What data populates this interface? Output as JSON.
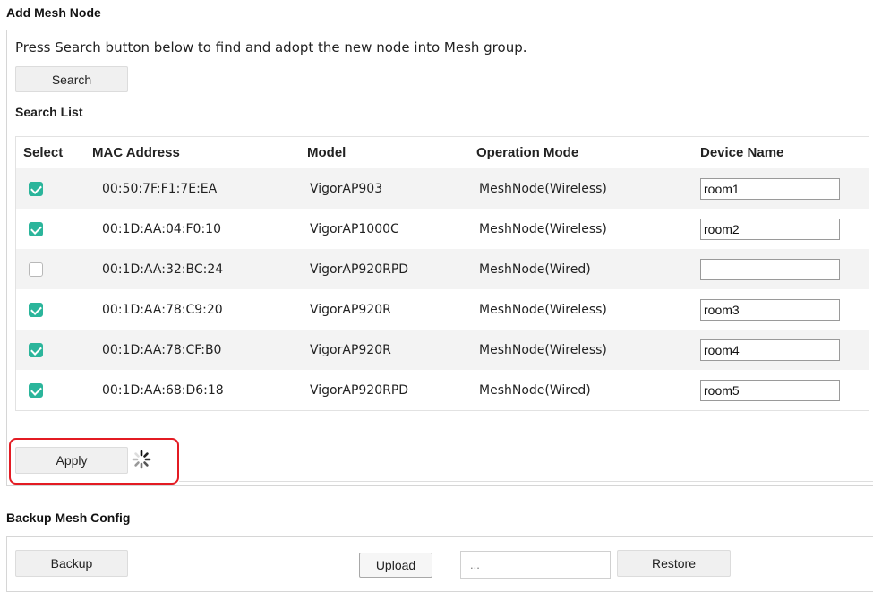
{
  "add_mesh_node": {
    "title": "Add Mesh Node",
    "description": "Press Search button below to find and adopt the new node into Mesh group.",
    "search_button": "Search",
    "search_list_title": "Search List",
    "columns": [
      "Select",
      "MAC Address",
      "Model",
      "Operation Mode",
      "Device Name"
    ],
    "rows": [
      {
        "selected": true,
        "mac": "00:50:7F:F1:7E:EA",
        "model": "VigorAP903",
        "mode": "MeshNode(Wireless)",
        "device_name": "room1"
      },
      {
        "selected": true,
        "mac": "00:1D:AA:04:F0:10",
        "model": "VigorAP1000C",
        "mode": "MeshNode(Wireless)",
        "device_name": "room2"
      },
      {
        "selected": false,
        "mac": "00:1D:AA:32:BC:24",
        "model": "VigorAP920RPD",
        "mode": "MeshNode(Wired)",
        "device_name": ""
      },
      {
        "selected": true,
        "mac": "00:1D:AA:78:C9:20",
        "model": "VigorAP920R",
        "mode": "MeshNode(Wireless)",
        "device_name": "room3"
      },
      {
        "selected": true,
        "mac": "00:1D:AA:78:CF:B0",
        "model": "VigorAP920R",
        "mode": "MeshNode(Wireless)",
        "device_name": "room4"
      },
      {
        "selected": true,
        "mac": "00:1D:AA:68:D6:18",
        "model": "VigorAP920RPD",
        "mode": "MeshNode(Wired)",
        "device_name": "room5"
      }
    ],
    "apply_button": "Apply",
    "checkbox_color": "#2bb59b",
    "highlight_color": "#e31b23"
  },
  "backup_mesh_config": {
    "title": "Backup Mesh Config",
    "backup_button": "Backup",
    "upload_button": "Upload",
    "file_placeholder": "...",
    "restore_button": "Restore"
  },
  "icons": {
    "spinner": "loading-spinner-icon"
  }
}
